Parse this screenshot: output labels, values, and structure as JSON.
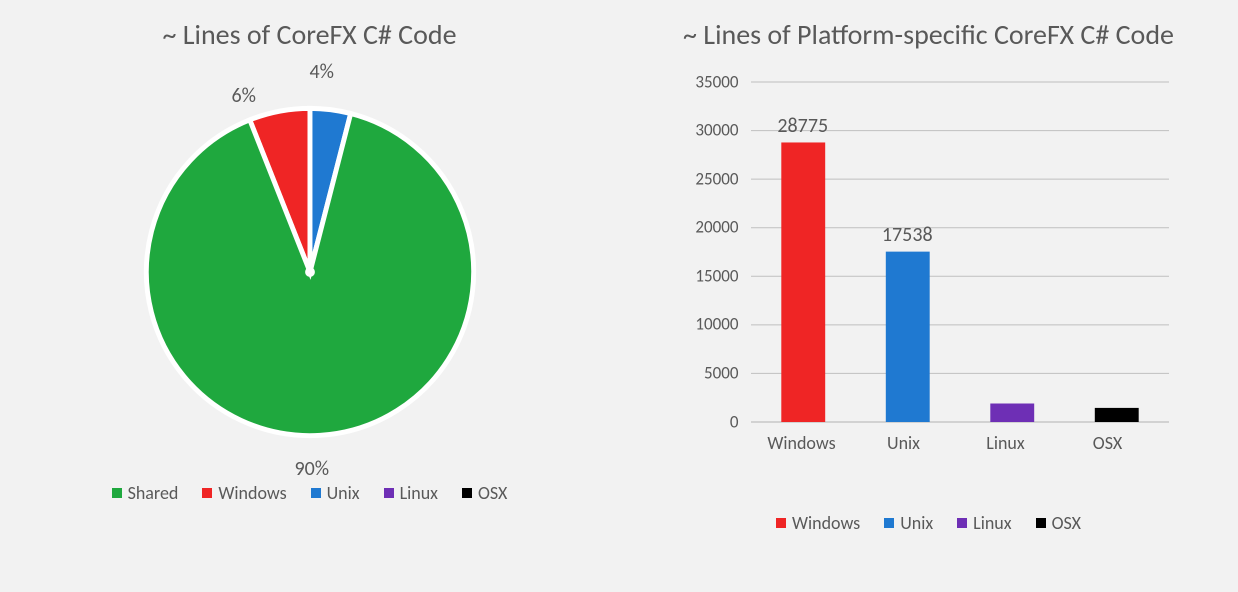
{
  "colors": {
    "shared": "#1fa83e",
    "windows": "#ef2525",
    "unix": "#1f79d1",
    "linux": "#6e2fb5",
    "osx": "#000000",
    "axis": "#bfbfbf",
    "text": "#595959"
  },
  "pie": {
    "title": "~ Lines of CoreFX C# Code",
    "labels": {
      "shared": "90%",
      "windows": "6%",
      "unix": "4%"
    },
    "legend": [
      {
        "key": "shared",
        "name": "Shared"
      },
      {
        "key": "windows",
        "name": "Windows"
      },
      {
        "key": "unix",
        "name": "Unix"
      },
      {
        "key": "linux",
        "name": "Linux"
      },
      {
        "key": "osx",
        "name": "OSX"
      }
    ]
  },
  "bar": {
    "title": "~ Lines of Platform-specific CoreFX C# Code",
    "ylim": [
      0,
      35000
    ],
    "ystep": 5000,
    "categories": [
      "Windows",
      "Unix",
      "Linux",
      "OSX"
    ],
    "legend": [
      {
        "key": "windows",
        "name": "Windows"
      },
      {
        "key": "unix",
        "name": "Unix"
      },
      {
        "key": "linux",
        "name": "Linux"
      },
      {
        "key": "osx",
        "name": "OSX"
      }
    ]
  },
  "chart_data": [
    {
      "type": "pie",
      "title": "~ Lines of CoreFX C# Code",
      "series": [
        {
          "name": "Shared",
          "value": 90
        },
        {
          "name": "Windows",
          "value": 6
        },
        {
          "name": "Unix",
          "value": 4
        },
        {
          "name": "Linux",
          "value": 0
        },
        {
          "name": "OSX",
          "value": 0
        }
      ],
      "value_unit": "percent"
    },
    {
      "type": "bar",
      "title": "~ Lines of Platform-specific CoreFX C# Code",
      "categories": [
        "Windows",
        "Unix",
        "Linux",
        "OSX"
      ],
      "values": [
        28775,
        17538,
        1904,
        1451
      ],
      "ylim": [
        0,
        35000
      ],
      "ylabel": "",
      "xlabel": "",
      "data_labels_shown": [
        "Windows",
        "Unix"
      ]
    }
  ]
}
